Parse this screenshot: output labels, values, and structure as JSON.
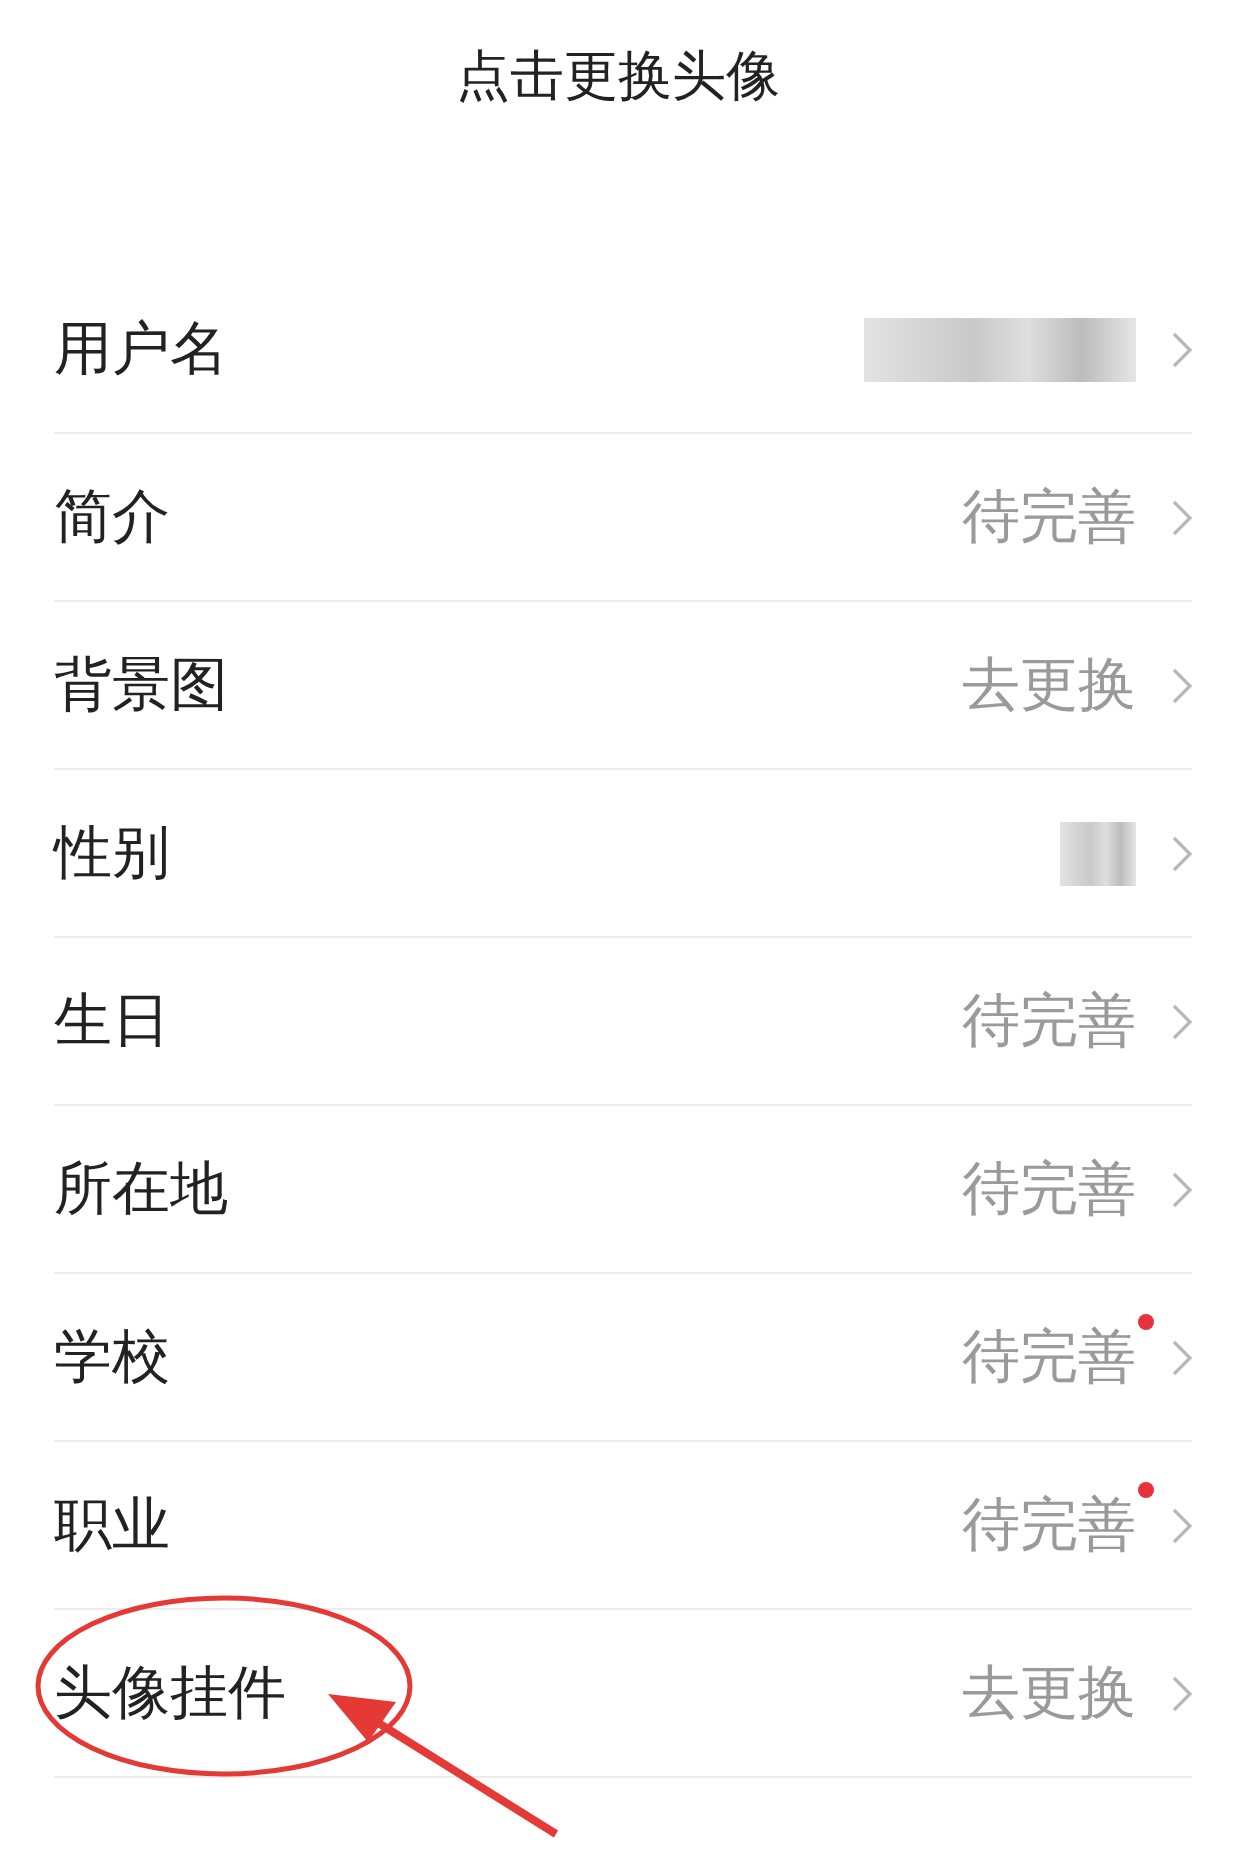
{
  "header": {
    "title": "点击更换头像"
  },
  "rows": [
    {
      "label": "用户名",
      "kind": "redacted",
      "dot": false,
      "highlighted": false
    },
    {
      "label": "简介",
      "kind": "text",
      "value": "待完善",
      "dot": false,
      "highlighted": false
    },
    {
      "label": "背景图",
      "kind": "text",
      "value": "去更换",
      "dot": false,
      "highlighted": false
    },
    {
      "label": "性别",
      "kind": "redacted",
      "dot": false,
      "highlighted": false
    },
    {
      "label": "生日",
      "kind": "text",
      "value": "待完善",
      "dot": false,
      "highlighted": false
    },
    {
      "label": "所在地",
      "kind": "text",
      "value": "待完善",
      "dot": false,
      "highlighted": false
    },
    {
      "label": "学校",
      "kind": "text",
      "value": "待完善",
      "dot": true,
      "highlighted": false
    },
    {
      "label": "职业",
      "kind": "text",
      "value": "待完善",
      "dot": true,
      "highlighted": false
    },
    {
      "label": "头像挂件",
      "kind": "text",
      "value": "去更换",
      "dot": false,
      "highlighted": true
    }
  ]
}
